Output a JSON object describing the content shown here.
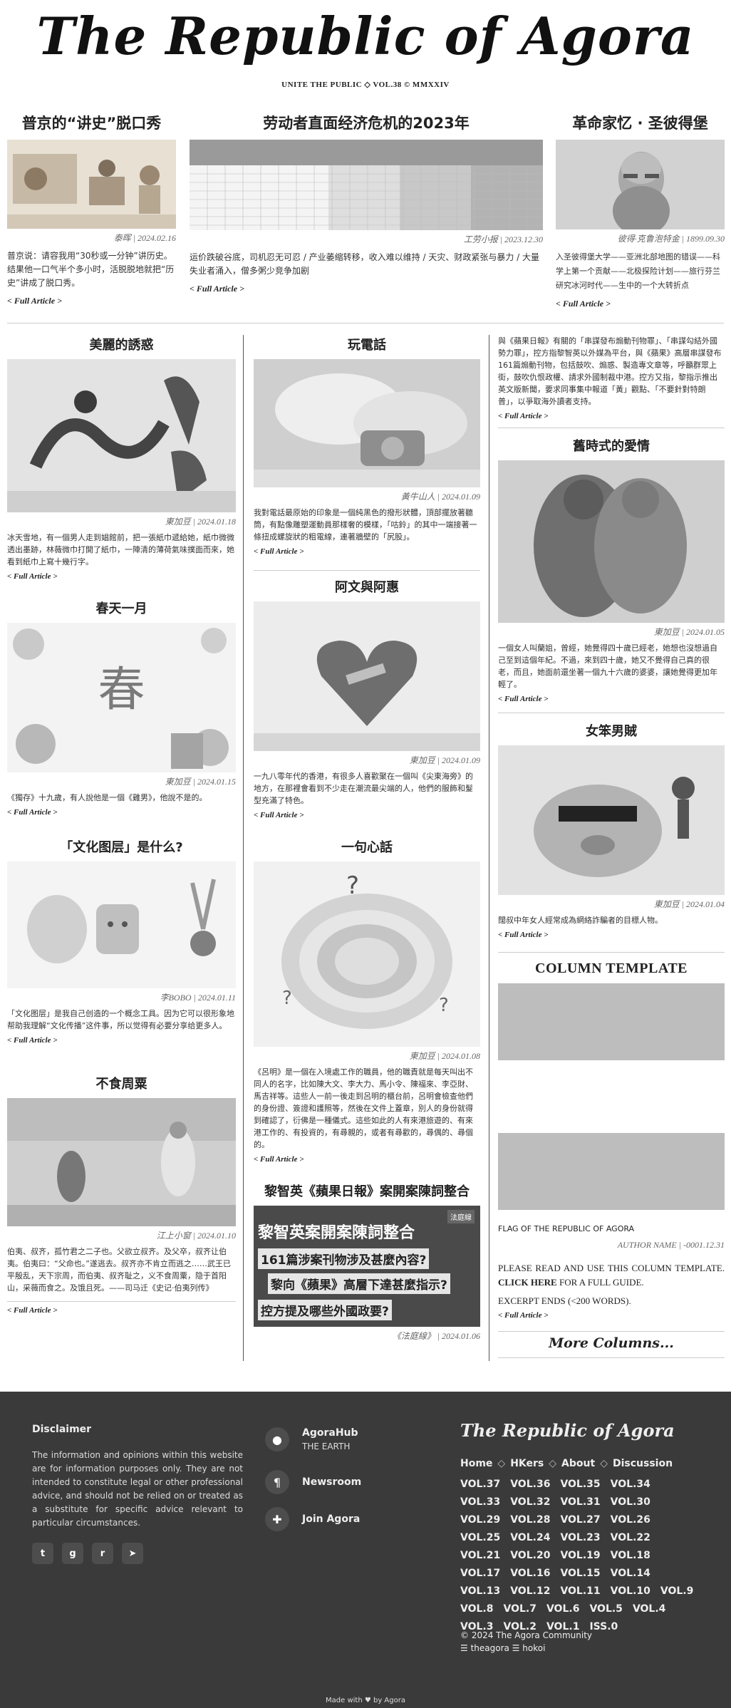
{
  "masthead": {
    "title": "The Republic of Agora",
    "subtitle": "UNITE THE PUBLIC ◇ VOL.38 © MMXXIV"
  },
  "top_articles": [
    {
      "headline": "普京的“讲史”脱口秀",
      "meta": "泰晖 | 2024.02.16",
      "summary": "普京说：请容我用“30秒或一分钟”讲历史。结果他一口气半个多小时，活脱脱地就把“历史”讲成了脱口秀。",
      "full": "Full Article"
    },
    {
      "headline": "劳动者直面经济危机的2023年",
      "meta": "工劳小报 | 2023.12.30",
      "summary": "运价跌破谷底，司机忍无可忍 / 产业萎缩转移，收入难以维持 / 天灾、财政紧张与暴力 / 大量失业者涌入，僧多粥少竞争加剧",
      "full": "Full Article"
    },
    {
      "headline": "革命家忆 · 圣彼得堡",
      "meta": "彼得·克鲁泡特金 | 1899.09.30",
      "summary": "入圣彼得堡大学——亚洲北部地图的错误——科学上第一个贡献——北极探险计划——旅行芬兰研究冰河时代——生中的一个大转折点",
      "full": "Full Article"
    }
  ],
  "col1": [
    {
      "headline": "美麗的誘惑",
      "meta": "東加豆 | 2024.01.18",
      "summary": "冰天雪地，有一個男人走到娼館前，把一張紙巾遞給她，紙巾微微透出墨跡，林薇微巾打開了紙巾，一陣清的薄荷氣味撲面而來，她看到紙巾上寫十幾行字。",
      "full": "Full Article"
    },
    {
      "headline": "春天一月",
      "meta": "東加豆 | 2024.01.15",
      "summary": "《獨存》十九歲，有人說他是一個《雞男》，他說不是的。",
      "full": "Full Article",
      "image_glyph": "春"
    },
    {
      "headline": "「文化图层」是什么?",
      "meta": "李BOBO | 2024.01.11",
      "summary": "「文化图层」是我自己创造的一个概念工具。因为它可以很形象地帮助我理解“文化传播”这件事，所以觉得有必要分享给更多人。",
      "full": "Full Article"
    },
    {
      "headline": "不食周粟",
      "meta": "江上小窗 | 2024.01.10",
      "summary": "伯夷、叔齐，孤竹君之二子也。父欲立叔齐。及父卒，叔齐让伯夷。伯夷曰：“父命也。”遂逃去。叔齐亦不肯立而逃之……武王已平殷乱，天下宗周，而伯夷、叔齐耻之，义不食周粟，隐于首阳山，采薇而食之。及饿且死。——司马迁《史记·伯夷列传》",
      "full": "Full Article"
    }
  ],
  "col2": [
    {
      "headline": "玩電話",
      "meta": "黃牛山人 | 2024.01.09",
      "summary": "我對電話最原始的印象是一個純黑色的撥形狀體，頂部擺放著聽筒，有點像雕塑運動員那樣奢的模樣，「咕鈴」的其中一端接著一條扭成螺旋狀的粗電線，連著牆壁的「尻股」。",
      "full": "Full Article"
    },
    {
      "headline": "阿文與阿惠",
      "meta": "東加豆 | 2024.01.09",
      "summary": "一九八零年代的香港，有很多人喜歡聚在一個叫《尖東海旁》的地方，在那裡會看到不少走在潮流最尖端的人，他們的服飾和髮型充滿了特色。",
      "full": "Full Article"
    },
    {
      "headline": "一句心話",
      "meta": "東加豆 | 2024.01.08",
      "summary": "《呂明》是一個在入境處工作的職員，他的職責就是每天叫出不同人的名字，比如陳大文、李大力、馬小令、陳福來、李亞財、馬吉祥等。這些人一前一後走到呂明的櫃台前，呂明會檢查他們的身份證、簽證和護照等，然後在文件上蓋章，別人的身份就得到確認了，衍佛是一種儀式。這些如此的人有來港旅遊的、有來港工作的、有投資的，有尋親的，或者有尋歡的，尋偶的、尋個的。",
      "full": "Full Article"
    },
    {
      "headline": "黎智英《蘋果日報》案開案陳詞整合",
      "meta": "《法庭線》 | 2024.01.06",
      "image_lines": [
        "黎智英案開案陳詞整合",
        "161篇涉案刊物涉及甚麼內容?",
        "黎向《蘋果》高層下達甚麼指示?",
        "控方提及哪些外國政要?"
      ],
      "image_tag": "法庭線"
    }
  ],
  "col3": [
    {
      "summary": "與《蘋果日報》有關的「串謀發布煽動刊物罪」、「串謀勾結外國勢力罪」，控方指黎智英以外媒為平台，與《蘋果》高層串謀發布161篇煽動刊物，包括鼓吹、煽惑、製造專文章等，呼籲群眾上街，鼓吹仇恨政權、請求外國制裁中港。控方又指，黎指示推出英文版新聞，要求同事集中報道「黃」觀點、「不要針對特朗普」，以爭取海外讀者支持。",
      "full": "Full Article"
    },
    {
      "headline": "舊時式的愛情",
      "meta": "東加豆 | 2024.01.05",
      "summary": "一個女人叫蘭姐，曾經，她覺得四十歲已經老，她想也沒想過自己至到這個年紀。不過，來到四十歲，她又不覺得自己真的很老，而且，她面前還坐著一個九十六歲的婆婆，讓她覺得更加年輕了。",
      "full": "Full Article"
    },
    {
      "headline": "女笨男賊",
      "meta": "東加豆 | 2024.01.04",
      "summary": "闊叔中年女人經常成為網絡詐騙者的目標人物。",
      "full": "Full Article"
    },
    {
      "template_title": "COLUMN TEMPLATE",
      "flag_label": "FLAG OF THE REPUBLIC OF AGORA",
      "meta": "AUTHOR NAME | -0001.12.31",
      "text_before": "PLEASE READ AND USE THIS COLUMN TEMPLATE. ",
      "text_link": "CLICK HERE",
      "text_after": " FOR A FULL GUIDE.",
      "excerpt": "EXCERPT ENDS (<200 WORDS).",
      "full": "Full Article"
    },
    {
      "more": "More Columns..."
    }
  ],
  "footer": {
    "disclaimer_title": "Disclaimer",
    "disclaimer_text": "The information and opinions within this website are for information purposes only. They are not intended to constitute legal or other professional advice, and should not be relied on or treated as a substitute for specific advice relevant to particular circumstances.",
    "links": [
      {
        "label": "AgoraHub",
        "sub": "THE EARTH",
        "icon": "location-pin-icon"
      },
      {
        "label": "Newsroom",
        "sub": "",
        "icon": "paragraph-icon"
      },
      {
        "label": "Join Agora",
        "sub": "",
        "icon": "puzzle-icon"
      }
    ],
    "brand": "The Republic of Agora",
    "nav": [
      "Home",
      "HKers",
      "About",
      "Discussion"
    ],
    "volumes": [
      "VOL.37",
      "VOL.36",
      "VOL.35",
      "VOL.34",
      "VOL.33",
      "VOL.32",
      "VOL.31",
      "VOL.30",
      "VOL.29",
      "VOL.28",
      "VOL.27",
      "VOL.26",
      "VOL.25",
      "VOL.24",
      "VOL.23",
      "VOL.22",
      "VOL.21",
      "VOL.20",
      "VOL.19",
      "VOL.18",
      "VOL.17",
      "VOL.16",
      "VOL.15",
      "VOL.14",
      "VOL.13",
      "VOL.12",
      "VOL.11",
      "VOL.10",
      "VOL.9",
      "VOL.8",
      "VOL.7",
      "VOL.6",
      "VOL.5",
      "VOL.4",
      "VOL.3",
      "VOL.2",
      "VOL.1",
      "ISS.0"
    ],
    "copyright": "© 2024 The Agora Community",
    "credits": "☰ theagora ☰ hokoi",
    "made_with": "Made with ♥ by Agora"
  }
}
